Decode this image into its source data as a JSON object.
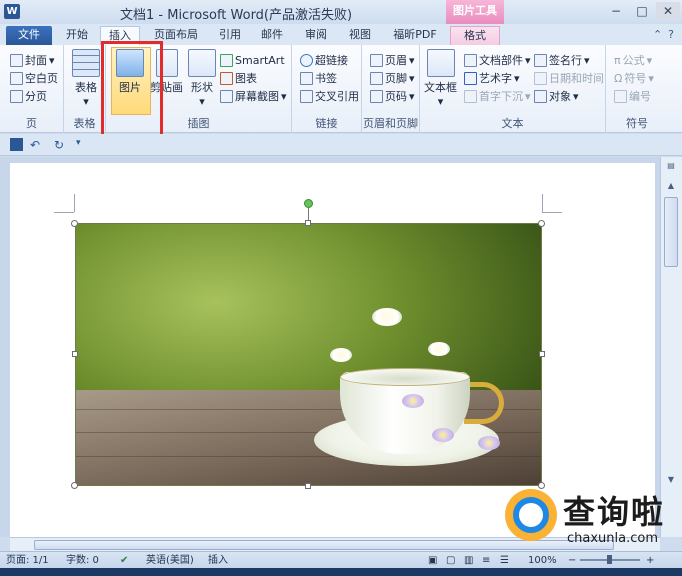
{
  "window": {
    "logo": "W",
    "title": "文档1 - Microsoft Word(产品激活失败)",
    "tool_tab_title": "图片工具",
    "minimize": "−",
    "maximize": "□",
    "close": "✕"
  },
  "tabs": [
    {
      "label": "文件"
    },
    {
      "label": "开始"
    },
    {
      "label": "插入"
    },
    {
      "label": "页面布局"
    },
    {
      "label": "引用"
    },
    {
      "label": "邮件"
    },
    {
      "label": "审阅"
    },
    {
      "label": "视图"
    },
    {
      "label": "福昕PDF"
    },
    {
      "label": "格式"
    }
  ],
  "ribbon": {
    "pages": {
      "label": "页",
      "cover": "封面",
      "blank": "空白页",
      "break": "分页"
    },
    "tables": {
      "label": "表格",
      "table": "表格"
    },
    "illustrations": {
      "label": "插图",
      "picture": "图片",
      "clipart": "剪贴画",
      "shapes": "形状",
      "smartart": "SmartArt",
      "chart": "图表",
      "screenshot": "屏幕截图"
    },
    "links": {
      "label": "链接",
      "hyperlink": "超链接",
      "bookmark": "书签",
      "crossref": "交叉引用"
    },
    "header_footer": {
      "label": "页眉和页脚",
      "header": "页眉",
      "footer": "页脚",
      "page_number": "页码"
    },
    "text": {
      "label": "文本",
      "textbox": "文本框",
      "quickparts": "文档部件",
      "wordart": "艺术字",
      "dropcap": "首字下沉",
      "signature": "签名行",
      "datetime": "日期和时间",
      "object": "对象"
    },
    "symbols": {
      "label": "符号",
      "equation": "公式",
      "symbol": "符号",
      "number": "编号"
    }
  },
  "statusbar": {
    "page": "页面: 1/1",
    "words": "字数: 0",
    "language": "英语(美国)",
    "mode": "插入",
    "zoom": "100%"
  },
  "watermark": {
    "text": "查询啦",
    "url": "chaxunla.com"
  },
  "colors": {
    "highlight": "#e22b2b",
    "file_tab": "#2b5797",
    "picture_tools": "#e98cbe"
  }
}
